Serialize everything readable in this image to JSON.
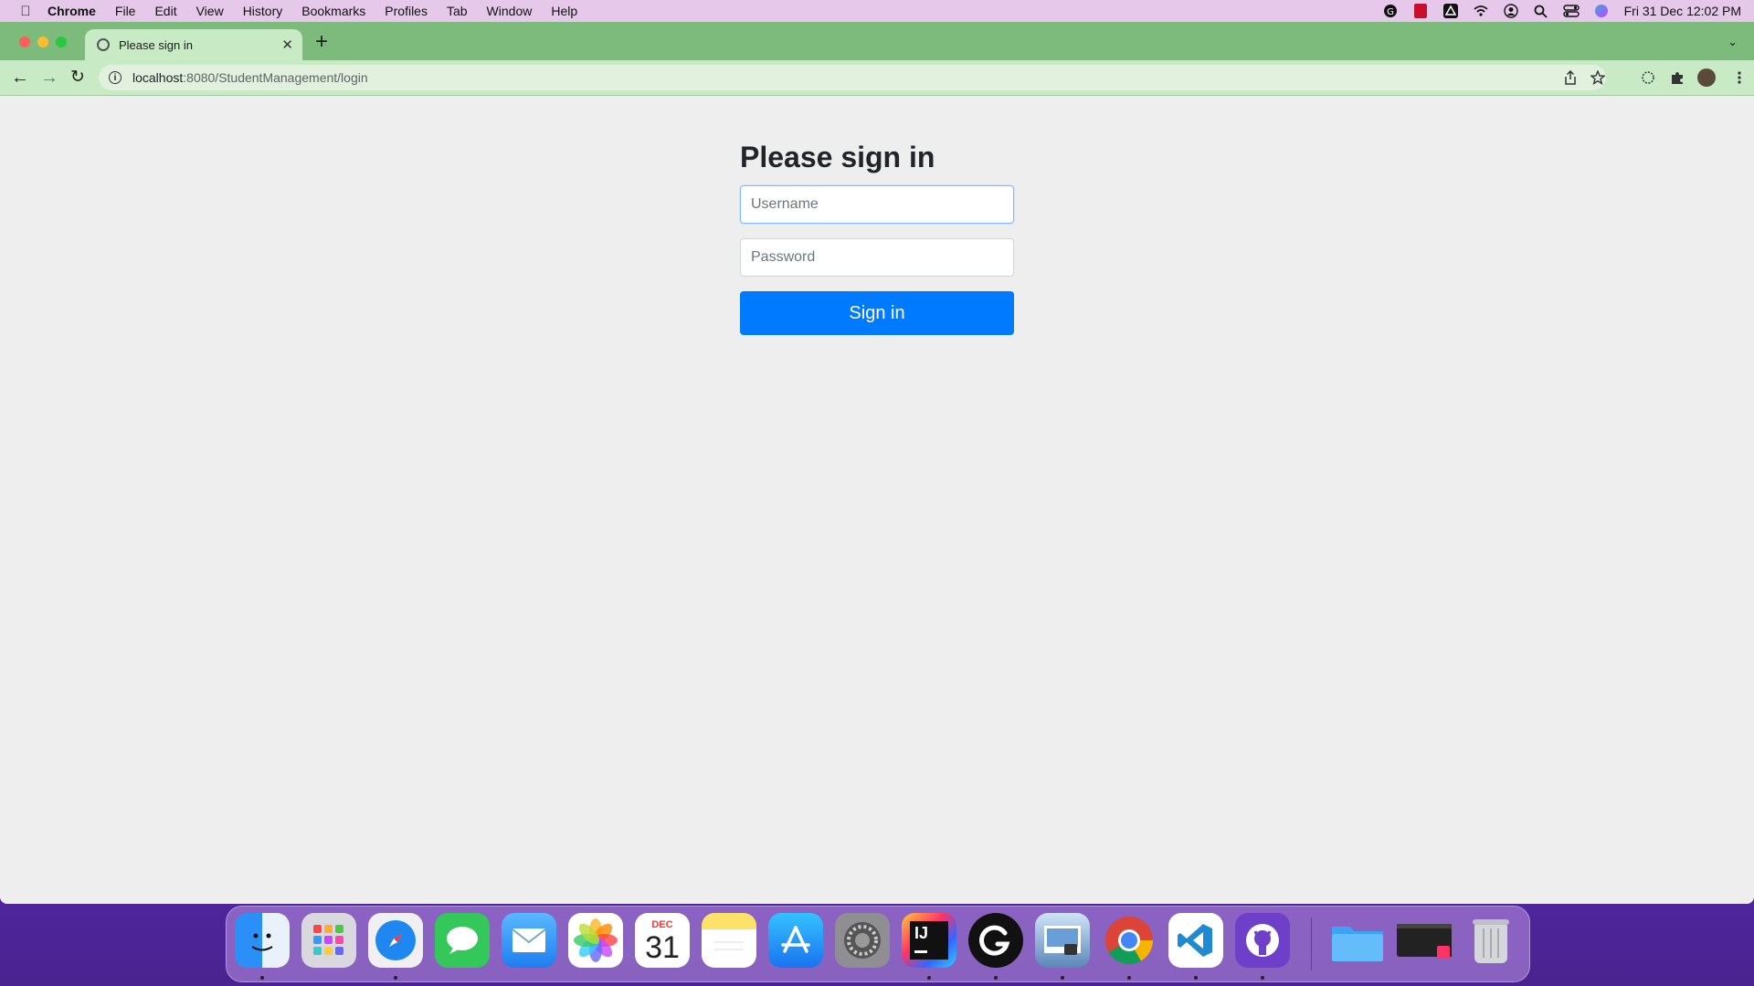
{
  "menubar": {
    "apple_icon": "apple-icon",
    "items": [
      "Chrome",
      "File",
      "Edit",
      "View",
      "History",
      "Bookmarks",
      "Profiles",
      "Tab",
      "Window",
      "Help"
    ],
    "clock": "Fri 31 Dec  12:02 PM",
    "status_icons": [
      "grammarly-icon",
      "adobe-icon",
      "drive-icon",
      "wifi-icon",
      "user-icon",
      "search-icon",
      "control-center-icon",
      "siri-icon"
    ]
  },
  "browser": {
    "tab_title": "Please sign in",
    "url_host": "localhost",
    "url_path": ":8080/StudentManagement/login",
    "accent_tabstrip": "#7cbb7c"
  },
  "login": {
    "heading": "Please sign in",
    "username_placeholder": "Username",
    "password_placeholder": "Password",
    "submit_label": "Sign in",
    "button_color": "#007bff"
  },
  "dock": {
    "calendar_month": "DEC",
    "calendar_day": "31",
    "intellij_label": "IJ",
    "apps": [
      "Finder",
      "Launchpad",
      "Safari",
      "Messages",
      "Mail",
      "Photos",
      "Calendar",
      "Notes",
      "App Store",
      "System Preferences",
      "IntelliJ IDEA",
      "Grammarly",
      "Preview",
      "Google Chrome",
      "Visual Studio Code",
      "GitHub Desktop",
      "Folder",
      "Terminal",
      "Trash"
    ]
  }
}
